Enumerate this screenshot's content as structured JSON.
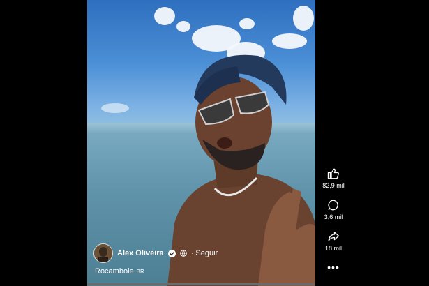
{
  "player": {
    "progress_fraction": 0.0
  },
  "author": {
    "name": "Alex Oliveira",
    "follow_label": "· Seguir",
    "verified_icon": "verified-check-icon",
    "privacy_icon": "globe-icon"
  },
  "audio": {
    "title": "Rocambole",
    "tag": "BR"
  },
  "actions": {
    "likes": "82,9 mil",
    "comments": "3,6 mil",
    "shares": "18 mil",
    "more_icon": "more-dots-icon"
  }
}
